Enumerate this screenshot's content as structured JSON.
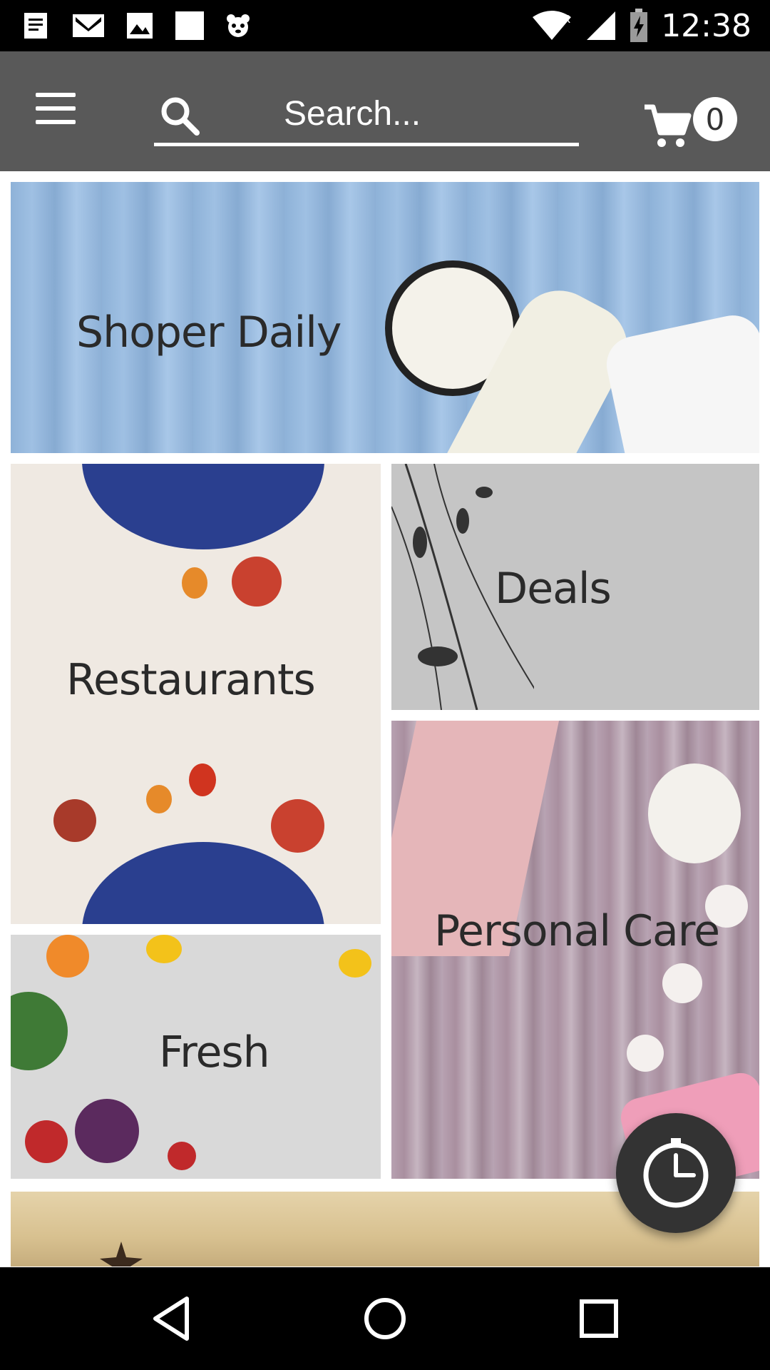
{
  "status_bar": {
    "time": "12:38",
    "left_icons": [
      "notes-icon",
      "gmail-icon",
      "gallery-icon",
      "square-icon",
      "panda-icon"
    ],
    "right_icons": [
      "wifi-icon",
      "signal-icon",
      "battery-charging-icon"
    ]
  },
  "app_bar": {
    "search": {
      "placeholder": "Search..."
    },
    "cart": {
      "count": "0"
    }
  },
  "tiles": {
    "daily": "Shoper Daily",
    "restaurants": "Restaurants",
    "deals": "Deals",
    "personal_care": "Personal Care",
    "fresh": "Fresh"
  },
  "nav_bar": {
    "buttons": [
      "back-icon",
      "home-icon",
      "recents-icon"
    ]
  }
}
